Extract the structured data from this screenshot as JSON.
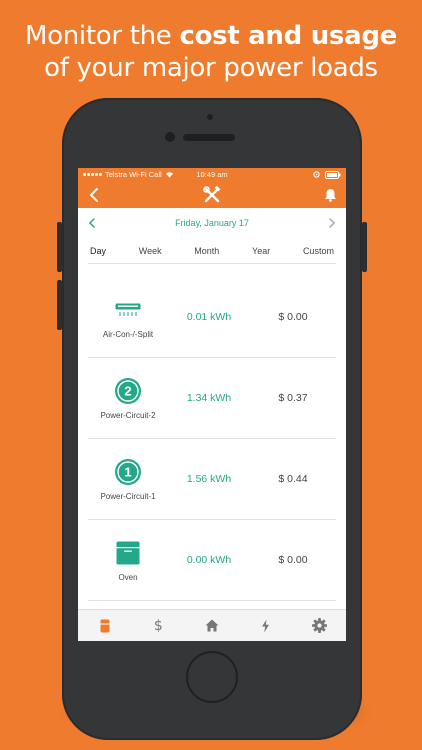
{
  "headline": {
    "line1_prefix": "Monitor the ",
    "line1_bold": "cost and usage",
    "line2": "of your major power loads"
  },
  "status_bar": {
    "carrier": "Telstra Wi-Fi Call",
    "time": "10:49 am"
  },
  "nav": {
    "back_icon": "chevron-left-icon",
    "logo_icon": "tools-logo-icon",
    "bell_icon": "bell-icon"
  },
  "date_nav": {
    "date": "Friday, January 17"
  },
  "period_tabs": [
    {
      "label": "Day"
    },
    {
      "label": "Week"
    },
    {
      "label": "Month"
    },
    {
      "label": "Year"
    },
    {
      "label": "Custom"
    }
  ],
  "loads": [
    {
      "name": "Air-Con-/-Split",
      "kwh": "0.01 kWh",
      "cost": "$ 0.00",
      "icon": "air-conditioner-icon"
    },
    {
      "name": "Power-Circuit-2",
      "kwh": "1.34 kWh",
      "cost": "$ 0.37",
      "icon": "circuit-2-icon"
    },
    {
      "name": "Power-Circuit-1",
      "kwh": "1.56 kWh",
      "cost": "$ 0.44",
      "icon": "circuit-1-icon"
    },
    {
      "name": "Oven",
      "kwh": "0.00 kWh",
      "cost": "$ 0.00",
      "icon": "oven-icon"
    }
  ],
  "tab_bar": {
    "dollar_label": "$",
    "items": [
      "appliance-icon",
      "dollar-icon",
      "home-icon",
      "lightning-icon",
      "gear-icon"
    ]
  },
  "colors": {
    "brand_orange": "#ee7b2e",
    "accent_teal": "#23a889",
    "phone_body": "#353638"
  }
}
